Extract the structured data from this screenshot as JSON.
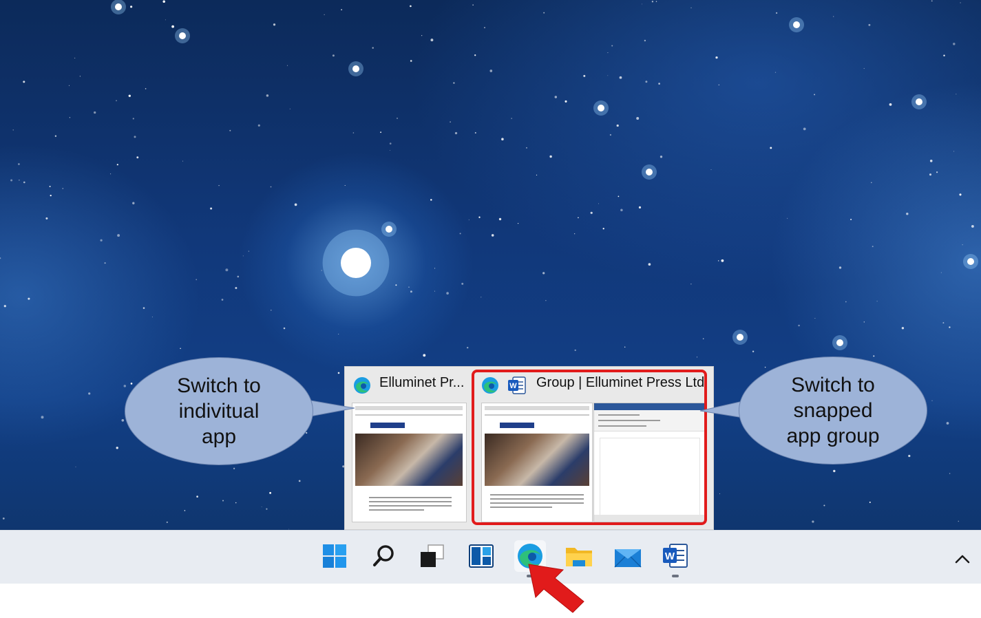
{
  "preview": {
    "individual_title": "Elluminet Pr...",
    "group_title": "Group | Elluminet Press Ltd..."
  },
  "callouts": {
    "left": [
      "Switch to",
      "indivitual",
      "app"
    ],
    "right": [
      "Switch to",
      "snapped",
      "app group"
    ]
  },
  "taskbar": {
    "icons": [
      "windows-start-icon",
      "search-icon",
      "task-view-icon",
      "widgets-icon",
      "edge-icon",
      "file-explorer-icon",
      "mail-icon",
      "word-icon"
    ],
    "active": "edge-icon",
    "highlight_color": "#e11b1b",
    "callout_color": "#9db3d8"
  }
}
